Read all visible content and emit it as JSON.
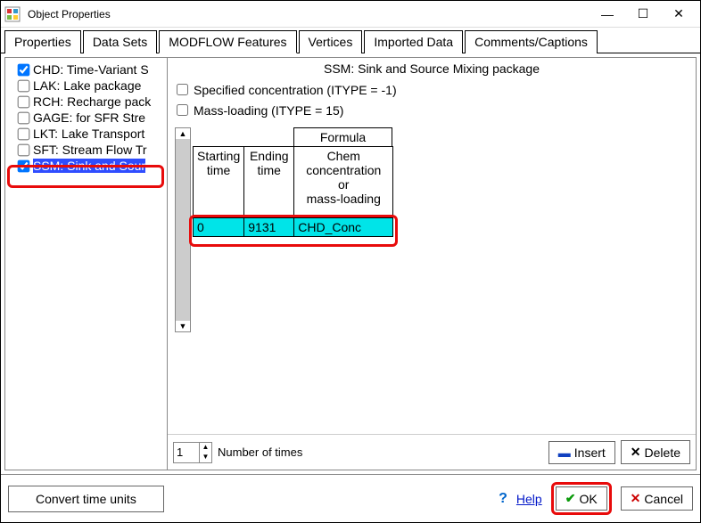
{
  "window": {
    "title": "Object Properties"
  },
  "tabs": [
    "Properties",
    "Data Sets",
    "MODFLOW Features",
    "Vertices",
    "Imported Data",
    "Comments/Captions"
  ],
  "active_tab_index": 2,
  "tree": {
    "items": [
      {
        "label": "CHD: Time-Variant S",
        "checked": true
      },
      {
        "label": "LAK: Lake package",
        "checked": false
      },
      {
        "label": "RCH: Recharge pack",
        "checked": false
      },
      {
        "label": "GAGE: for SFR Stre",
        "checked": false
      },
      {
        "label": "LKT: Lake Transport",
        "checked": false
      },
      {
        "label": "SFT: Stream Flow Tr",
        "checked": false
      },
      {
        "label": "SSM: Sink and Sour",
        "checked": true,
        "selected": true
      }
    ]
  },
  "panel": {
    "title": "SSM: Sink and Source Mixing package",
    "chk_specified": "Specified concentration (ITYPE = -1)",
    "chk_massloading": "Mass-loading (ITYPE = 15)",
    "formula_label": "Formula",
    "headers": {
      "start": "Starting\ntime",
      "end": "Ending\ntime",
      "chem": "Chem\nconcentration\nor\nmass-loading"
    },
    "row": {
      "start": "0",
      "end": "9131",
      "chem": "CHD_Conc"
    },
    "num_times_value": "1",
    "num_times_label": "Number of times",
    "insert": "Insert",
    "delete": "Delete"
  },
  "bottom": {
    "convert": "Convert time units",
    "help": "Help",
    "ok": "OK",
    "cancel": "Cancel"
  }
}
